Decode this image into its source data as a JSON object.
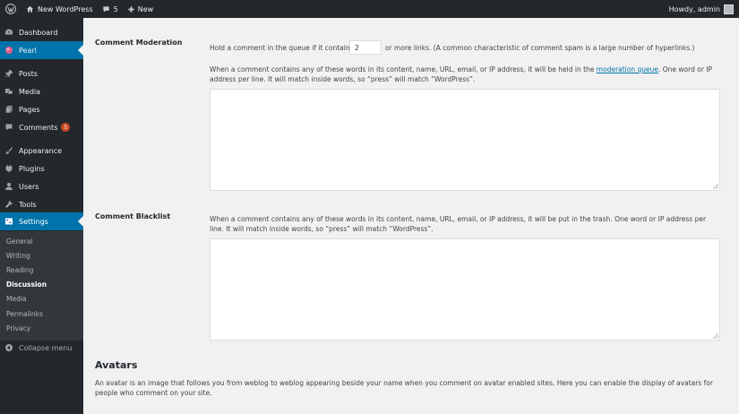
{
  "adminbar": {
    "site_name": "New WordPress",
    "comments_count": "5",
    "new_label": "New",
    "howdy": "Howdy, admin"
  },
  "sidebar": {
    "items": [
      {
        "label": "Dashboard",
        "icon": "dashboard-icon"
      },
      {
        "label": "Pearl",
        "icon": "pearl-icon"
      },
      {
        "label": "Posts",
        "icon": "pin-icon"
      },
      {
        "label": "Media",
        "icon": "media-icon"
      },
      {
        "label": "Pages",
        "icon": "pages-icon"
      },
      {
        "label": "Comments",
        "icon": "comment-icon",
        "badge": "5"
      },
      {
        "label": "Appearance",
        "icon": "brush-icon"
      },
      {
        "label": "Plugins",
        "icon": "plug-icon"
      },
      {
        "label": "Users",
        "icon": "user-icon"
      },
      {
        "label": "Tools",
        "icon": "wrench-icon"
      },
      {
        "label": "Settings",
        "icon": "settings-icon"
      }
    ],
    "submenu": [
      "General",
      "Writing",
      "Reading",
      "Discussion",
      "Media",
      "Permalinks",
      "Privacy"
    ],
    "collapse_label": "Collapse menu"
  },
  "moderation": {
    "label": "Comment Moderation",
    "hold_prefix": "Hold a comment in the queue if it contains",
    "links_value": "2",
    "hold_suffix": "or more links. (A common characteristic of comment spam is a large number of hyperlinks.)",
    "desc_part1": "When a comment contains any of these words in its content, name, URL, email, or IP address, it will be held in the",
    "desc_link": "moderation queue",
    "desc_part2": ". One word or IP address per line. It will match inside words, so “press” will match “WordPress”.",
    "textarea_value": ""
  },
  "blacklist": {
    "label": "Comment Blacklist",
    "desc": "When a comment contains any of these words in its content, name, URL, email, or IP address, it will be put in the trash. One word or IP address per line. It will match inside words, so “press” will match “WordPress”.",
    "textarea_value": ""
  },
  "avatars": {
    "heading": "Avatars",
    "desc": "An avatar is an image that follows you from weblog to weblog appearing beside your name when you comment on avatar enabled sites. Here you can enable the display of avatars for people who comment on your site."
  },
  "colors": {
    "adminbar_bg": "#23282d",
    "sidebar_bg": "#23282d",
    "submenu_bg": "#32373c",
    "accent": "#0073aa",
    "badge": "#ca4a1f",
    "content_bg": "#f1f1f1"
  }
}
